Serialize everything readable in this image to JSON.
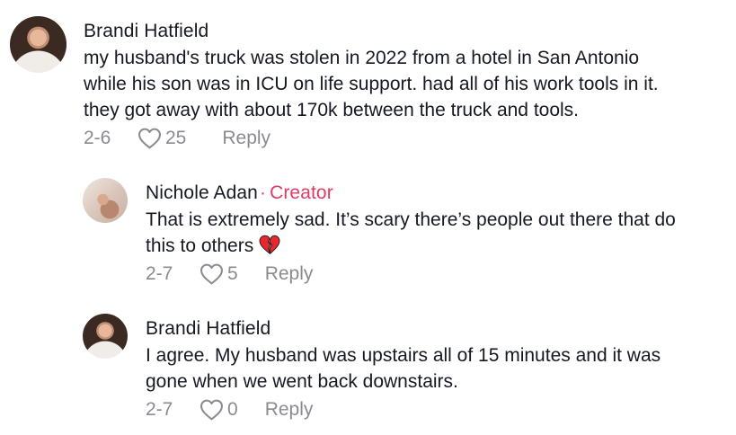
{
  "comments": [
    {
      "username": "Brandi Hatfield",
      "lines": [
        "my husband's truck was stolen in 2022 from a hotel in San Antonio",
        "while his son was in ICU on life support. had all of his work tools in it.",
        "they got away with about 170k between the truck and tools."
      ],
      "date": "2-6",
      "likes": "25",
      "reply_label": "Reply"
    }
  ],
  "replies": [
    {
      "username": "Nichole Adan",
      "creator_label": "Creator",
      "separator": "·",
      "lines": [
        "That is extremely sad. It’s scary there’s people out there that do",
        "this to others"
      ],
      "emoji": "broken-heart-icon",
      "date": "2-7",
      "likes": "5",
      "reply_label": "Reply"
    },
    {
      "username": "Brandi Hatfield",
      "lines": [
        "I agree. My husband was upstairs all of 15 minutes and it was",
        "gone when we went back downstairs."
      ],
      "date": "2-7",
      "likes": "0",
      "reply_label": "Reply"
    }
  ],
  "colors": {
    "text": "#161823",
    "meta": "#8a8b91",
    "creator": "#e13b63",
    "broken_heart": "#e8282f"
  }
}
